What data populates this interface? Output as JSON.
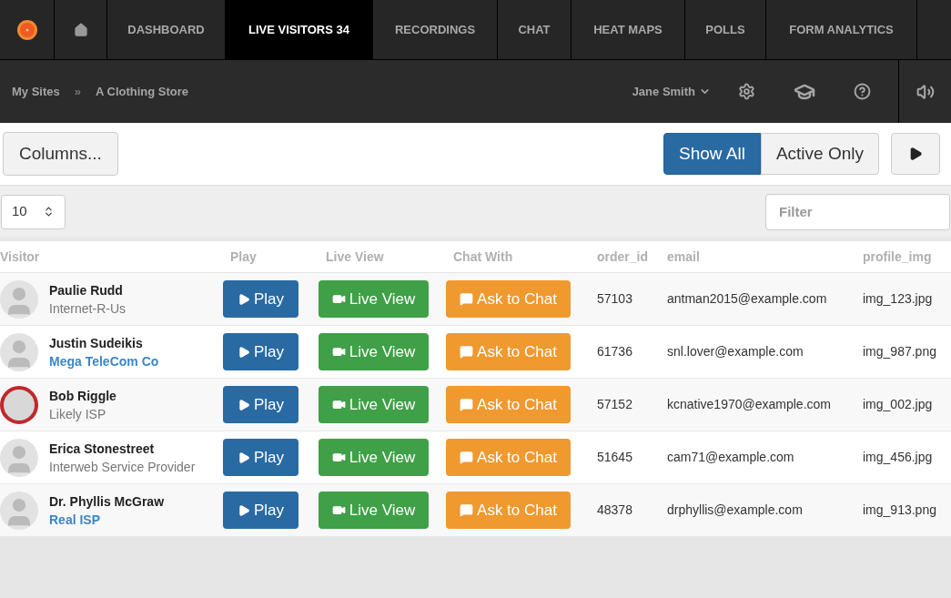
{
  "nav": {
    "tabs": [
      {
        "label": "DASHBOARD",
        "selected": false
      },
      {
        "label": "LIVE VISITORS 34",
        "selected": true
      },
      {
        "label": "RECORDINGS",
        "selected": false
      },
      {
        "label": "CHAT",
        "selected": false
      },
      {
        "label": "HEAT MAPS",
        "selected": false
      },
      {
        "label": "POLLS",
        "selected": false
      },
      {
        "label": "FORM ANALYTICS",
        "selected": false
      }
    ]
  },
  "breadcrumb": {
    "items": [
      "My Sites",
      "A Clothing Store"
    ],
    "separator": "»"
  },
  "user_menu": {
    "name": "Jane Smith"
  },
  "toolbar": {
    "columns_button": "Columns...",
    "filters": [
      {
        "label": "Show All",
        "selected": true
      },
      {
        "label": "Active Only",
        "selected": false
      }
    ]
  },
  "page_size": {
    "value": "10"
  },
  "filter": {
    "placeholder": "Filter"
  },
  "table": {
    "columns": [
      "Visitor",
      "Play",
      "Live View",
      "Chat With",
      "order_id",
      "email",
      "profile_img"
    ],
    "rows": [
      {
        "name": "Paulie Rudd",
        "isp": "Internet-R-Us",
        "isp_link": false,
        "avatar": {
          "kind": "generic"
        },
        "play": "Play",
        "live": "Live View",
        "chat": "Ask to Chat",
        "order_id": "57103",
        "email": "antman2015@example.com",
        "profile_img": "img_123.jpg"
      },
      {
        "name": "Justin Sudeikis",
        "isp": "Mega TeleCom Co",
        "isp_link": true,
        "avatar": {
          "kind": "generic"
        },
        "play": "Play",
        "live": "Live View",
        "chat": "Ask to Chat",
        "order_id": "61736",
        "email": "snl.lover@example.com",
        "profile_img": "img_987.png"
      },
      {
        "name": "Bob Riggle",
        "isp": "Likely ISP",
        "isp_link": false,
        "avatar": {
          "kind": "image"
        },
        "play": "Play",
        "live": "Live View",
        "chat": "Ask to Chat",
        "order_id": "57152",
        "email": "kcnative1970@example.com",
        "profile_img": "img_002.jpg"
      },
      {
        "name": "Erica Stonestreet",
        "isp": "Interweb Service Provider",
        "isp_link": false,
        "avatar": {
          "kind": "generic"
        },
        "play": "Play",
        "live": "Live View",
        "chat": "Ask to Chat",
        "order_id": "51645",
        "email": "cam71@example.com",
        "profile_img": "img_456.jpg"
      },
      {
        "name": "Dr. Phyllis McGraw",
        "isp": "Real ISP",
        "isp_link": true,
        "avatar": {
          "kind": "generic"
        },
        "play": "Play",
        "live": "Live View",
        "chat": "Ask to Chat",
        "order_id": "48378",
        "email": "drphyllis@example.com",
        "profile_img": "img_913.png"
      }
    ]
  }
}
